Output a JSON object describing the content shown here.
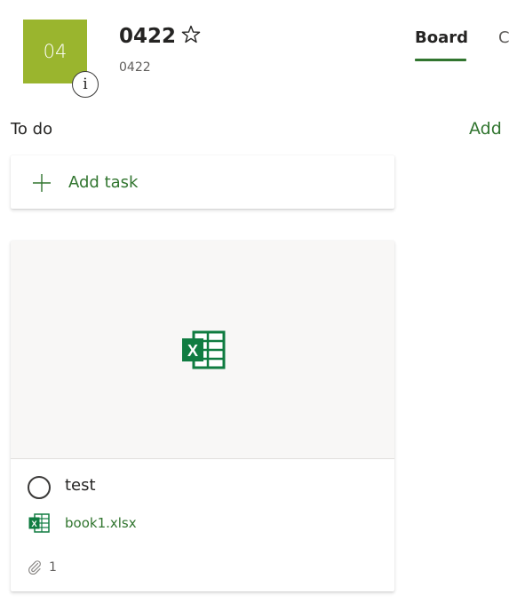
{
  "plan": {
    "tile_text": "04",
    "info_glyph": "i",
    "title": "0422",
    "subtitle": "0422",
    "tile_color": "#9ab52e"
  },
  "tabs": {
    "board": "Board",
    "next_partial": "C"
  },
  "bucket": {
    "title": "To do",
    "add_label": "Add"
  },
  "add_task": {
    "label": "Add task",
    "icon": "plus-icon"
  },
  "task": {
    "title": "test",
    "attachment": {
      "name": "book1.xlsx",
      "icon": "excel-icon"
    },
    "attachment_count": "1"
  },
  "colors": {
    "accent": "#31752f",
    "excel": "#107c41"
  }
}
